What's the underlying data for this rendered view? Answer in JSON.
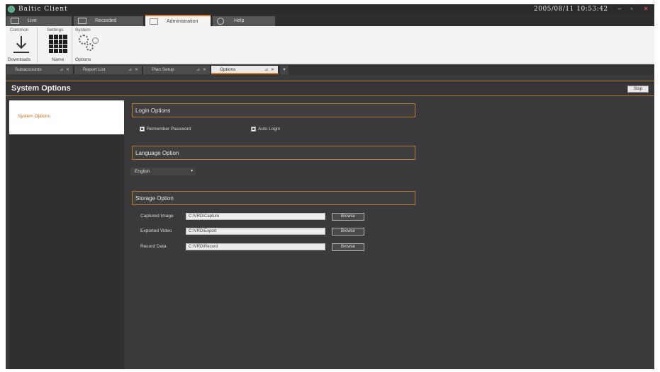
{
  "window": {
    "title": "Baltic Client",
    "clock": "2005/08/11 10:53:42",
    "min": "–",
    "max": "▫",
    "close": "×"
  },
  "ribbon_tabs": [
    {
      "label": "Live",
      "icon": "monitor-icon"
    },
    {
      "label": "Recorded",
      "icon": "film-icon"
    },
    {
      "label": "Administration",
      "icon": "admin-icon",
      "active": true
    },
    {
      "label": "Help",
      "icon": "help-icon"
    }
  ],
  "ribbon": {
    "groups": [
      {
        "label": "Common",
        "buttons": [
          {
            "label": "Downloads",
            "icon": "download-icon"
          }
        ]
      },
      {
        "label": "Settings",
        "buttons": [
          {
            "label": "Name",
            "icon": "grid-icon"
          }
        ]
      },
      {
        "label": "System",
        "buttons": [
          {
            "label": "Options",
            "icon": "gears-icon"
          }
        ]
      }
    ]
  },
  "doc_tabs": [
    {
      "label": "Subaccounts",
      "controls": "⊿ ✕"
    },
    {
      "label": "Report List",
      "controls": "⊿ ✕"
    },
    {
      "label": "Plan Setup",
      "controls": "⊿ ✕"
    },
    {
      "label": "Options",
      "controls": "⊿ ✕",
      "active": true
    }
  ],
  "doc_tab_add": "▾",
  "header": {
    "title": "System Options",
    "stop_label": "Stop"
  },
  "sidebar": {
    "items": [
      {
        "label": "System Options",
        "active": true
      }
    ]
  },
  "sections": {
    "login": {
      "title": "Login Options",
      "remember": "Remember Password",
      "autologin": "Auto Login"
    },
    "language": {
      "title": "Language Option",
      "value": "English",
      "arrow": "▾"
    },
    "storage": {
      "title": "Storage Option",
      "rows": [
        {
          "label": "Captured Image",
          "path": "C:\\VRD\\Capture",
          "browse": "Browse"
        },
        {
          "label": "Exported Video",
          "path": "C:\\VRD\\Export",
          "browse": "Browse"
        },
        {
          "label": "Record Data",
          "path": "C:\\VRD\\Record",
          "browse": "Browse"
        }
      ]
    }
  },
  "colors": {
    "accent": "#e07b2a",
    "border": "#b8782f",
    "background": "#3a3a3a"
  }
}
